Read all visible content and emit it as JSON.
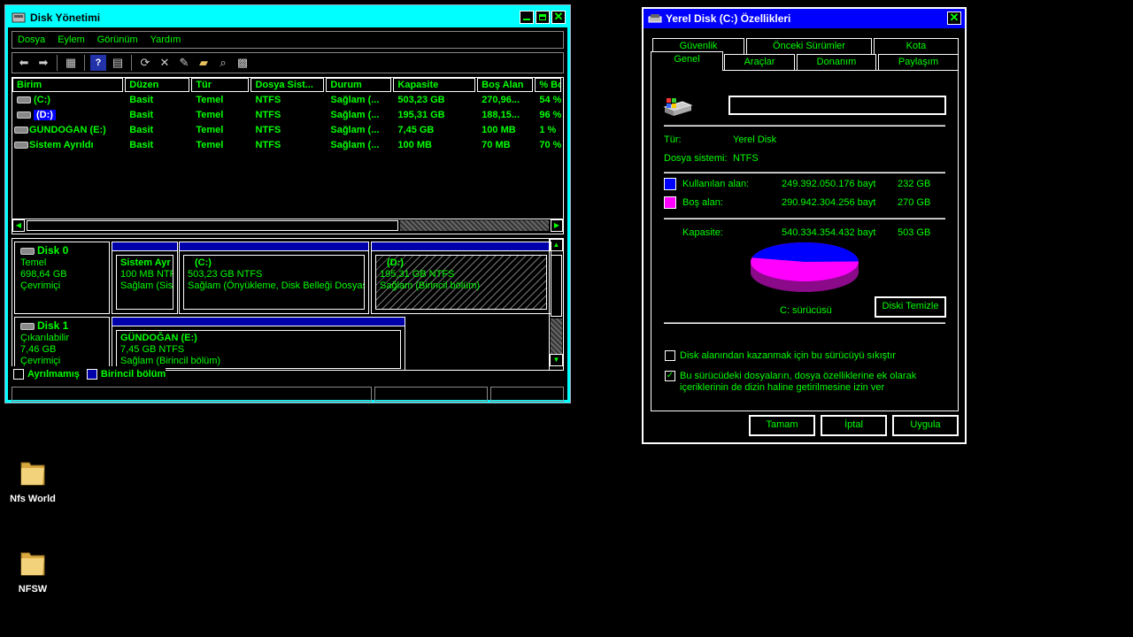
{
  "disk_mgmt": {
    "title": "Disk Yönetimi",
    "menu": [
      "Dosya",
      "Eylem",
      "Görünüm",
      "Yardım"
    ],
    "columns": [
      "Birim",
      "Düzen",
      "Tür",
      "Dosya Sist...",
      "Durum",
      "Kapasite",
      "Boş Alan",
      "% Bo"
    ],
    "rows": [
      {
        "volume": "(C:)",
        "layout": "Basit",
        "type": "Temel",
        "fs": "NTFS",
        "status": "Sağlam (...",
        "capacity": "503,23 GB",
        "free": "270,96...",
        "pct": "54 %"
      },
      {
        "volume": "(D:)",
        "layout": "Basit",
        "type": "Temel",
        "fs": "NTFS",
        "status": "Sağlam (...",
        "capacity": "195,31 GB",
        "free": "188,15...",
        "pct": "96 %"
      },
      {
        "volume": "GÜNDOĞAN (E:)",
        "layout": "Basit",
        "type": "Temel",
        "fs": "NTFS",
        "status": "Sağlam (...",
        "capacity": "7,45 GB",
        "free": "100 MB",
        "pct": "1 %"
      },
      {
        "volume": "Sistem Ayrıldı",
        "layout": "Basit",
        "type": "Temel",
        "fs": "NTFS",
        "status": "Sağlam (...",
        "capacity": "100 MB",
        "free": "70 MB",
        "pct": "70 %"
      }
    ],
    "disk0": {
      "name": "Disk 0",
      "type": "Temel",
      "size": "698,64 GB",
      "state": "Çevrimiçi",
      "p1": {
        "name": "Sistem Ayr",
        "size": "100 MB NTF",
        "status": "Sağlam (Siste"
      },
      "p2": {
        "name": "(C:)",
        "size": "503,23 GB NTFS",
        "status": "Sağlam (Önyükleme, Disk Belleği Dosyası,"
      },
      "p3": {
        "name": "(D:)",
        "size": "195,31 GB NTFS",
        "status": "Sağlam (Birincil bölüm)"
      }
    },
    "disk1": {
      "name": "Disk 1",
      "type": "Çıkarılabilir",
      "size": "7,46 GB",
      "state": "Çevrimiçi",
      "p1": {
        "name": "GÜNDOĞAN  (E:)",
        "size": "7,45 GB NTFS",
        "status": "Sağlam (Birincil bölüm)"
      }
    },
    "legend": {
      "unallocated": "Ayrılmamış",
      "primary": "Birincil bölüm"
    }
  },
  "props": {
    "title": "Yerel Disk (C:) Özellikleri",
    "tabs_back": [
      "Güvenlik",
      "Önceki Sürümler",
      "Kota"
    ],
    "tabs_front": [
      "Genel",
      "Araçlar",
      "Donanım",
      "Paylaşım"
    ],
    "name_value": "",
    "type_label": "Tür:",
    "type_value": "Yerel Disk",
    "fs_label": "Dosya sistemi:",
    "fs_value": "NTFS",
    "used_label": "Kullanılan alan:",
    "used_bytes": "249.392.050.176 bayt",
    "used_gb": "232 GB",
    "free_label": "Boş alan:",
    "free_bytes": "290.942.304.256 bayt",
    "free_gb": "270 GB",
    "cap_label": "Kapasite:",
    "cap_bytes": "540.334.354.432 bayt",
    "cap_gb": "503 GB",
    "used_fraction": 0.4616,
    "drive_label": "C: sürücüsü",
    "cleanup_label": "Diski Temizle",
    "compress_label": "Disk alanından kazanmak için bu sürücüyü sıkıştır",
    "compress_checked": false,
    "index_label_1": "Bu sürücüdeki dosyaların, dosya özelliklerine ek olarak",
    "index_label_2": "içeriklerinin de dizin haline getirilmesine izin ver",
    "index_checked": true,
    "ok": "Tamam",
    "cancel": "İptal",
    "apply": "Uygula",
    "colors": {
      "used": "#0000ff",
      "free": "#ff00ff"
    }
  },
  "desktop": {
    "icons": [
      "Nfs World",
      "NFSW"
    ]
  }
}
